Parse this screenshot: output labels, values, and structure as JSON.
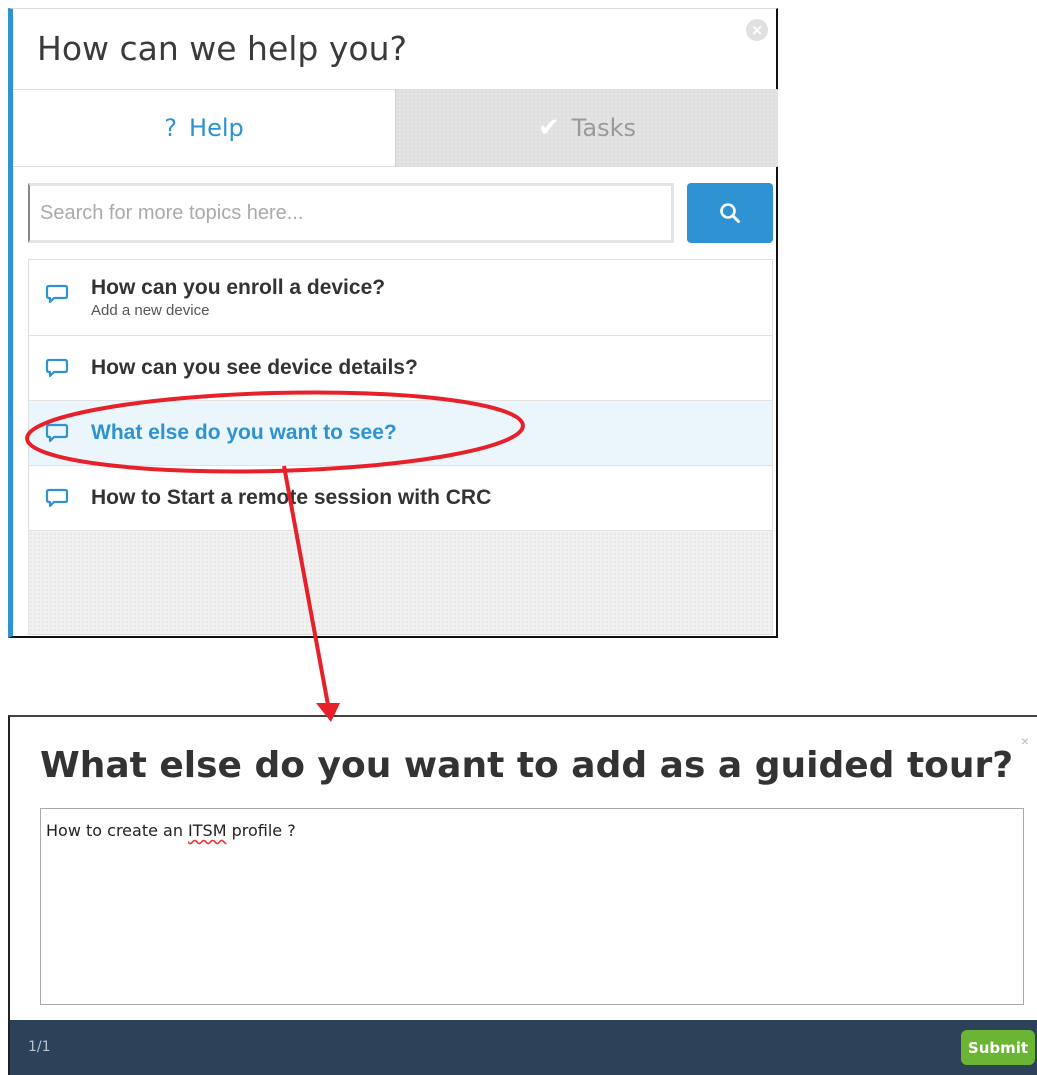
{
  "help_widget": {
    "title": "How can we help you?",
    "close_glyph": "×",
    "tabs": [
      {
        "icon": "?",
        "label": "Help",
        "active": true
      },
      {
        "icon": "✔",
        "label": "Tasks",
        "active": false
      }
    ],
    "search": {
      "placeholder": "Search for more topics here..."
    },
    "items": [
      {
        "title": "How can you enroll a device?",
        "subtitle": "Add a new device"
      },
      {
        "title": "How can you see device details?"
      },
      {
        "title": "What else do you want to see?"
      },
      {
        "title": "How to Start a remote session with CRC"
      }
    ]
  },
  "tour": {
    "title": "What else do you want to add as a guided tour?",
    "close_glyph": "×",
    "text_before": "How to create an ",
    "text_misspelled": "ITSM",
    "text_after": " profile ?",
    "page": "1/1",
    "submit_label": "Submit"
  },
  "colors": {
    "accent": "#2e92d3",
    "submit": "#6ab533",
    "footer": "#2b4258",
    "annotation": "#e8202a"
  }
}
